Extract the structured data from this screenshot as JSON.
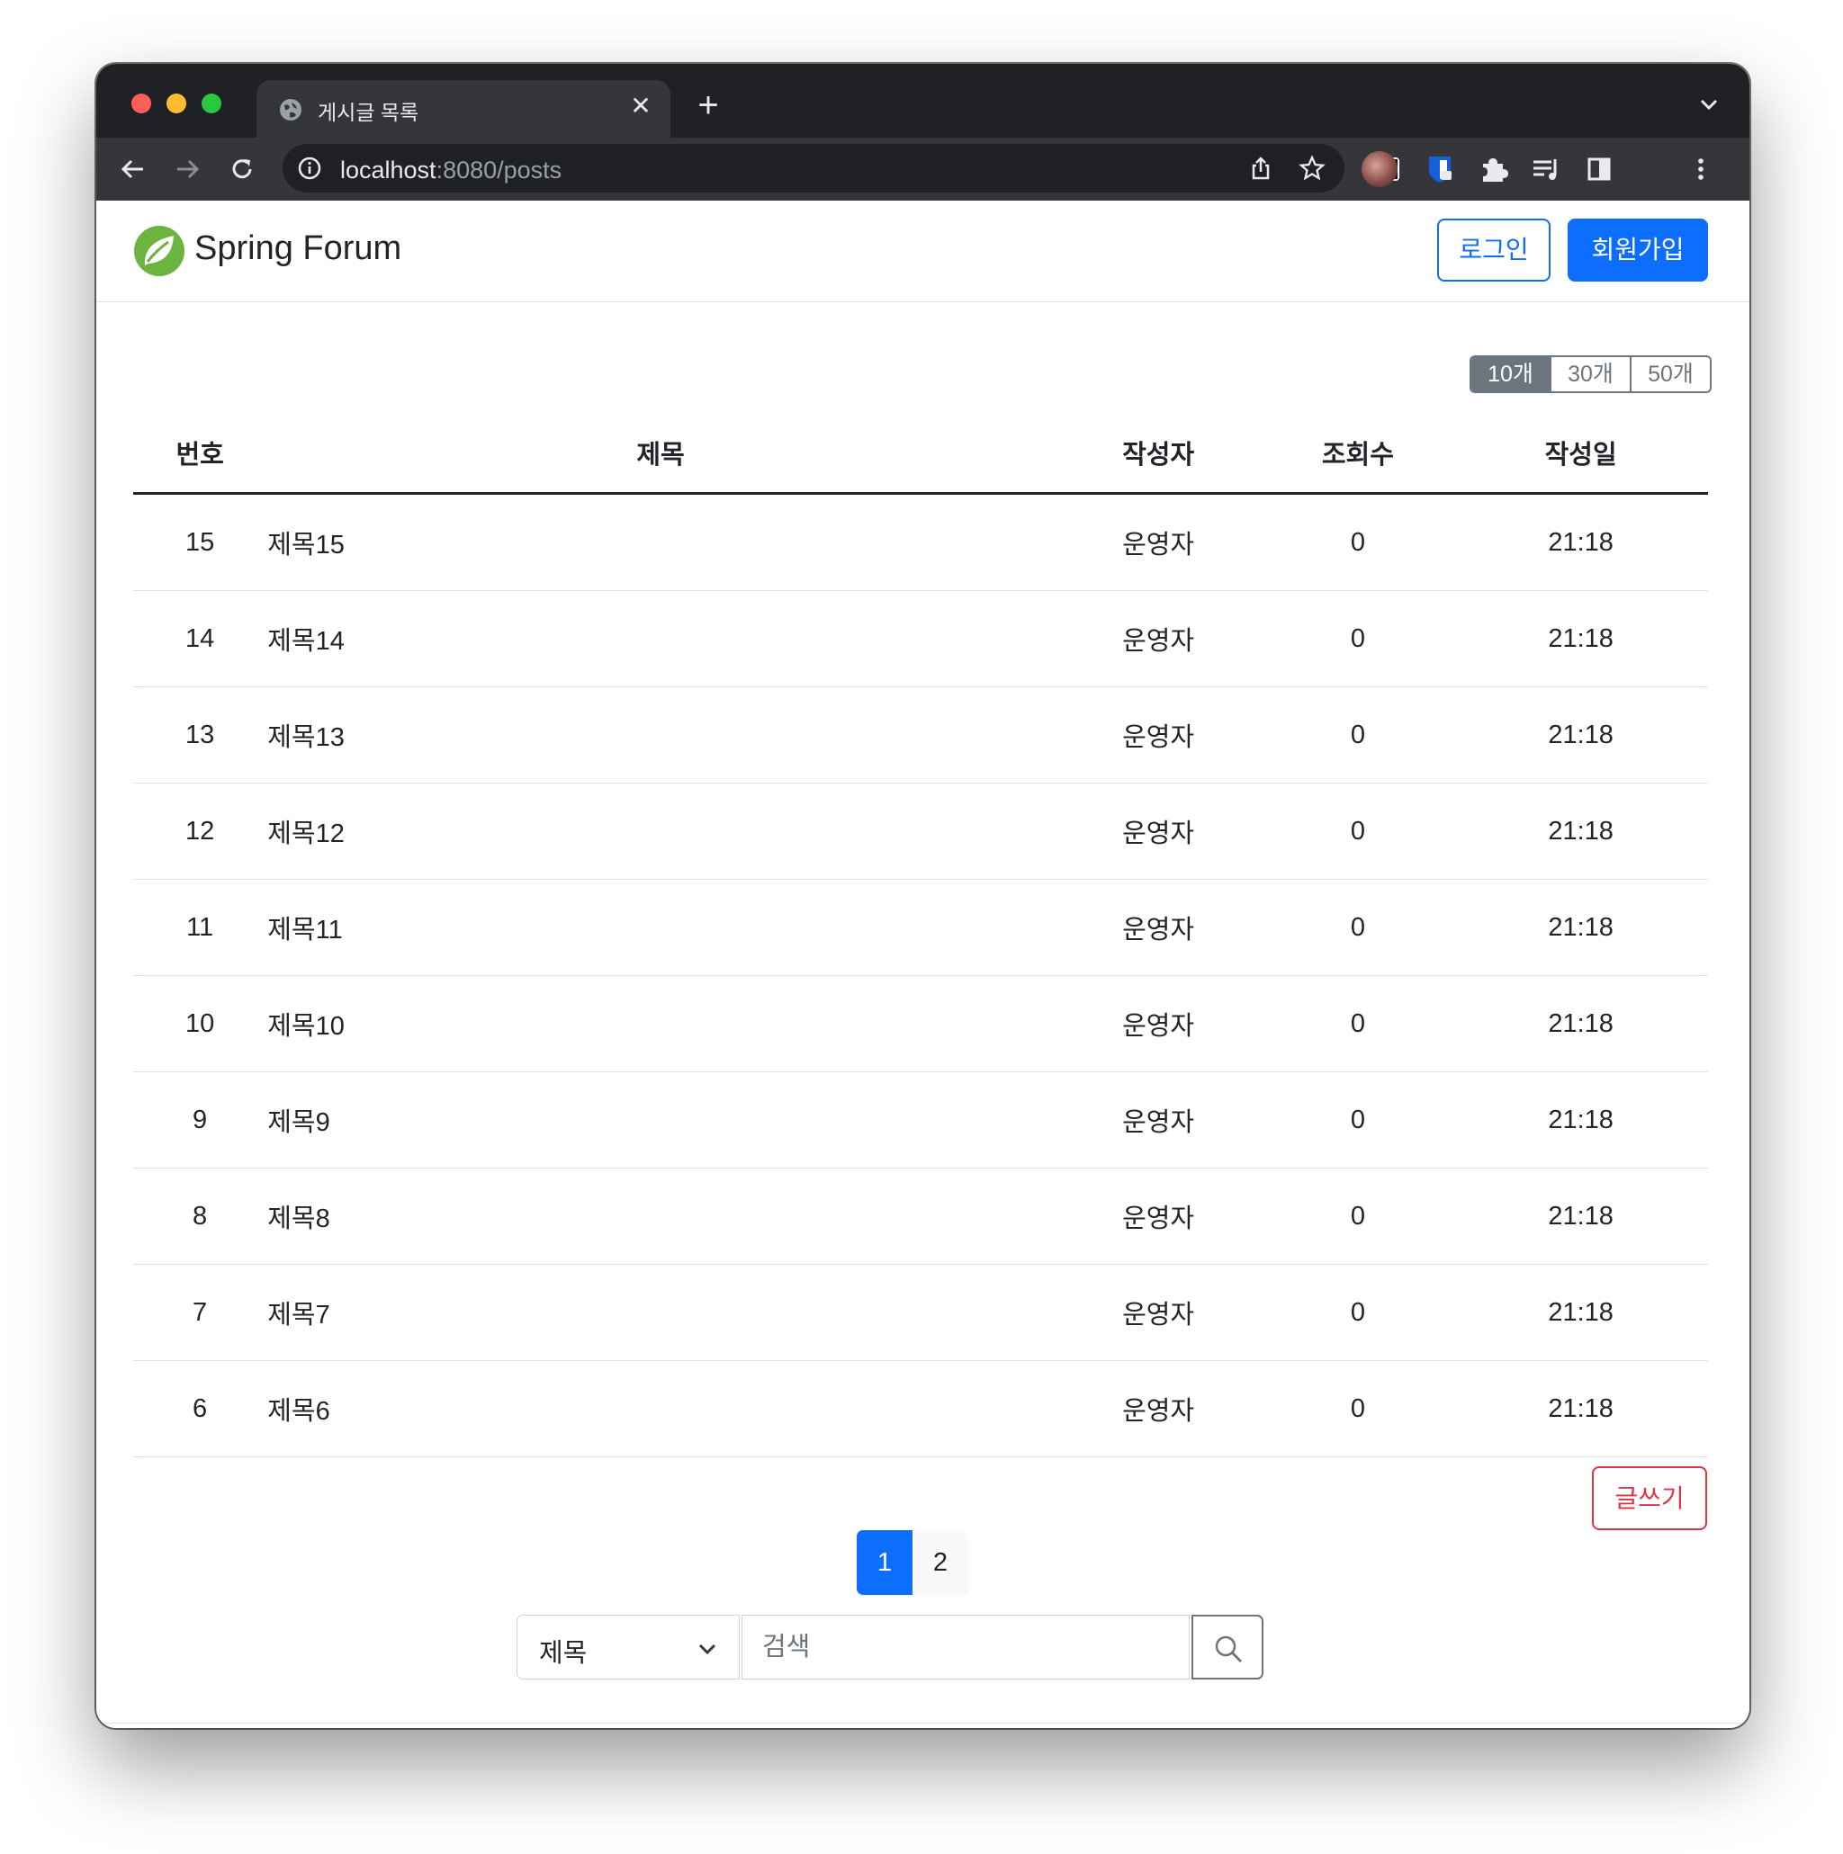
{
  "browser": {
    "tab_title": "게시글 목록",
    "url_host": "localhost",
    "url_rest": ":8080/posts"
  },
  "navbar": {
    "brand": "Spring Forum",
    "login_label": "로그인",
    "signup_label": "회원가입"
  },
  "page_size": {
    "options": [
      "10개",
      "30개",
      "50개"
    ],
    "selected": "10개"
  },
  "table": {
    "headers": [
      "번호",
      "제목",
      "작성자",
      "조회수",
      "작성일"
    ],
    "rows": [
      {
        "no": "15",
        "title": "제목15",
        "author": "운영자",
        "views": "0",
        "date": "21:18"
      },
      {
        "no": "14",
        "title": "제목14",
        "author": "운영자",
        "views": "0",
        "date": "21:18"
      },
      {
        "no": "13",
        "title": "제목13",
        "author": "운영자",
        "views": "0",
        "date": "21:18"
      },
      {
        "no": "12",
        "title": "제목12",
        "author": "운영자",
        "views": "0",
        "date": "21:18"
      },
      {
        "no": "11",
        "title": "제목11",
        "author": "운영자",
        "views": "0",
        "date": "21:18"
      },
      {
        "no": "10",
        "title": "제목10",
        "author": "운영자",
        "views": "0",
        "date": "21:18"
      },
      {
        "no": "9",
        "title": "제목9",
        "author": "운영자",
        "views": "0",
        "date": "21:18"
      },
      {
        "no": "8",
        "title": "제목8",
        "author": "운영자",
        "views": "0",
        "date": "21:18"
      },
      {
        "no": "7",
        "title": "제목7",
        "author": "운영자",
        "views": "0",
        "date": "21:18"
      },
      {
        "no": "6",
        "title": "제목6",
        "author": "운영자",
        "views": "0",
        "date": "21:18"
      }
    ]
  },
  "write_label": "글쓰기",
  "pagination": {
    "pages": [
      "1",
      "2"
    ],
    "current": "1"
  },
  "search": {
    "field_value": "제목",
    "placeholder": "검색"
  },
  "colors": {
    "primary": "#0d6efd",
    "danger": "#dc3545",
    "secondary": "#6c757d",
    "spring_green": "#6db33f"
  }
}
